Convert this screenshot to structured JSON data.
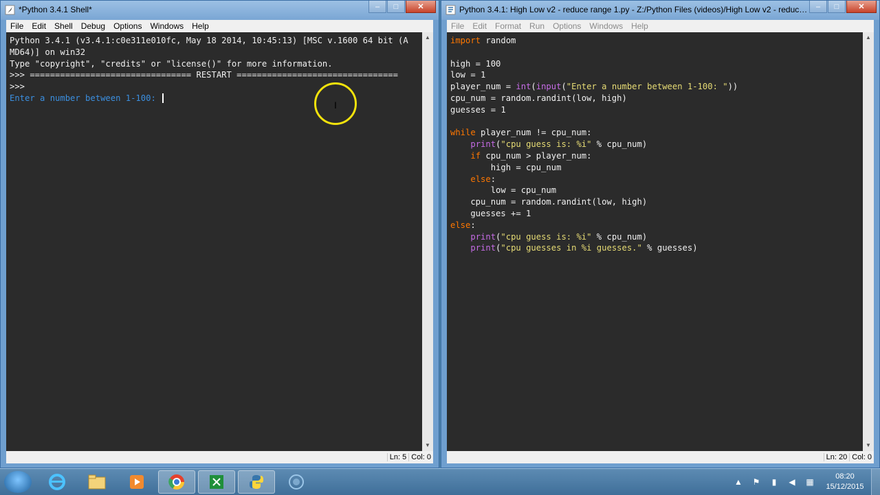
{
  "shell": {
    "title": "*Python 3.4.1 Shell*",
    "menu": [
      "File",
      "Edit",
      "Shell",
      "Debug",
      "Options",
      "Windows",
      "Help"
    ],
    "lines": [
      {
        "type": "prompt",
        "text": "Python 3.4.1 (v3.4.1:c0e311e010fc, May 18 2014, 10:45:13) [MSC v.1600 64 bit (A"
      },
      {
        "type": "prompt",
        "text": "MD64)] on win32"
      },
      {
        "type": "prompt",
        "text": "Type \"copyright\", \"credits\" or \"license()\" for more information."
      },
      {
        "type": "prompt",
        "text": ">>> ================================ RESTART ================================"
      },
      {
        "type": "prompt",
        "text": ">>> "
      },
      {
        "type": "stdout",
        "text": "Enter a number between 1-100: "
      }
    ],
    "status": {
      "ln": "Ln: 5",
      "col": "Col: 0"
    }
  },
  "editor": {
    "title": "Python 3.4.1: High Low v2 - reduce range 1.py - Z:/Python Files (videos)/High Low v2 - reduce range...",
    "menu": [
      "File",
      "Edit",
      "Format",
      "Run",
      "Options",
      "Windows",
      "Help"
    ],
    "code": [
      [
        {
          "t": "kw",
          "s": "import"
        },
        {
          "t": "def",
          "s": " random"
        }
      ],
      [],
      [
        {
          "t": "def",
          "s": "high = 100"
        }
      ],
      [
        {
          "t": "def",
          "s": "low = 1"
        }
      ],
      [
        {
          "t": "def",
          "s": "player_num = "
        },
        {
          "t": "bi",
          "s": "int"
        },
        {
          "t": "def",
          "s": "("
        },
        {
          "t": "bi",
          "s": "input"
        },
        {
          "t": "def",
          "s": "("
        },
        {
          "t": "str",
          "s": "\"Enter a number between 1-100: \""
        },
        {
          "t": "def",
          "s": "))"
        }
      ],
      [
        {
          "t": "def",
          "s": "cpu_num = random.randint(low, high)"
        }
      ],
      [
        {
          "t": "def",
          "s": "guesses = 1"
        }
      ],
      [],
      [
        {
          "t": "kw",
          "s": "while"
        },
        {
          "t": "def",
          "s": " player_num != cpu_num:"
        }
      ],
      [
        {
          "t": "def",
          "s": "    "
        },
        {
          "t": "bi",
          "s": "print"
        },
        {
          "t": "def",
          "s": "("
        },
        {
          "t": "str",
          "s": "\"cpu guess is: %i\""
        },
        {
          "t": "def",
          "s": " % cpu_num)"
        }
      ],
      [
        {
          "t": "def",
          "s": "    "
        },
        {
          "t": "kw",
          "s": "if"
        },
        {
          "t": "def",
          "s": " cpu_num > player_num:"
        }
      ],
      [
        {
          "t": "def",
          "s": "        high = cpu_num"
        }
      ],
      [
        {
          "t": "def",
          "s": "    "
        },
        {
          "t": "kw",
          "s": "else"
        },
        {
          "t": "def",
          "s": ":"
        }
      ],
      [
        {
          "t": "def",
          "s": "        low = cpu_num"
        }
      ],
      [
        {
          "t": "def",
          "s": "    cpu_num = random.randint(low, high)"
        }
      ],
      [
        {
          "t": "def",
          "s": "    guesses += 1"
        }
      ],
      [
        {
          "t": "kw",
          "s": "else"
        },
        {
          "t": "def",
          "s": ":"
        }
      ],
      [
        {
          "t": "def",
          "s": "    "
        },
        {
          "t": "bi",
          "s": "print"
        },
        {
          "t": "def",
          "s": "("
        },
        {
          "t": "str",
          "s": "\"cpu guess is: %i\""
        },
        {
          "t": "def",
          "s": " % cpu_num)"
        }
      ],
      [
        {
          "t": "def",
          "s": "    "
        },
        {
          "t": "bi",
          "s": "print"
        },
        {
          "t": "def",
          "s": "("
        },
        {
          "t": "str",
          "s": "\"cpu guesses in %i guesses.\""
        },
        {
          "t": "def",
          "s": " % guesses)"
        }
      ]
    ],
    "status": {
      "ln": "Ln: 20",
      "col": "Col: 0"
    }
  },
  "caption_buttons": {
    "minimize": "–",
    "maximize": "□",
    "close": "✕"
  },
  "taskbar": {
    "apps": [
      "windows-explorer",
      "internet-explorer",
      "file-manager",
      "media-player",
      "chrome",
      "spreadsheet",
      "python-idle",
      "recorder"
    ],
    "time": "08:20",
    "date": "15/12/2015"
  },
  "colors": {
    "keyword": "#ff7700",
    "builtin": "#c66ce6",
    "string": "#e6db74",
    "stdout": "#3b8fe0",
    "background": "#2b2b2b",
    "cursor_highlight": "#f2e20c"
  }
}
